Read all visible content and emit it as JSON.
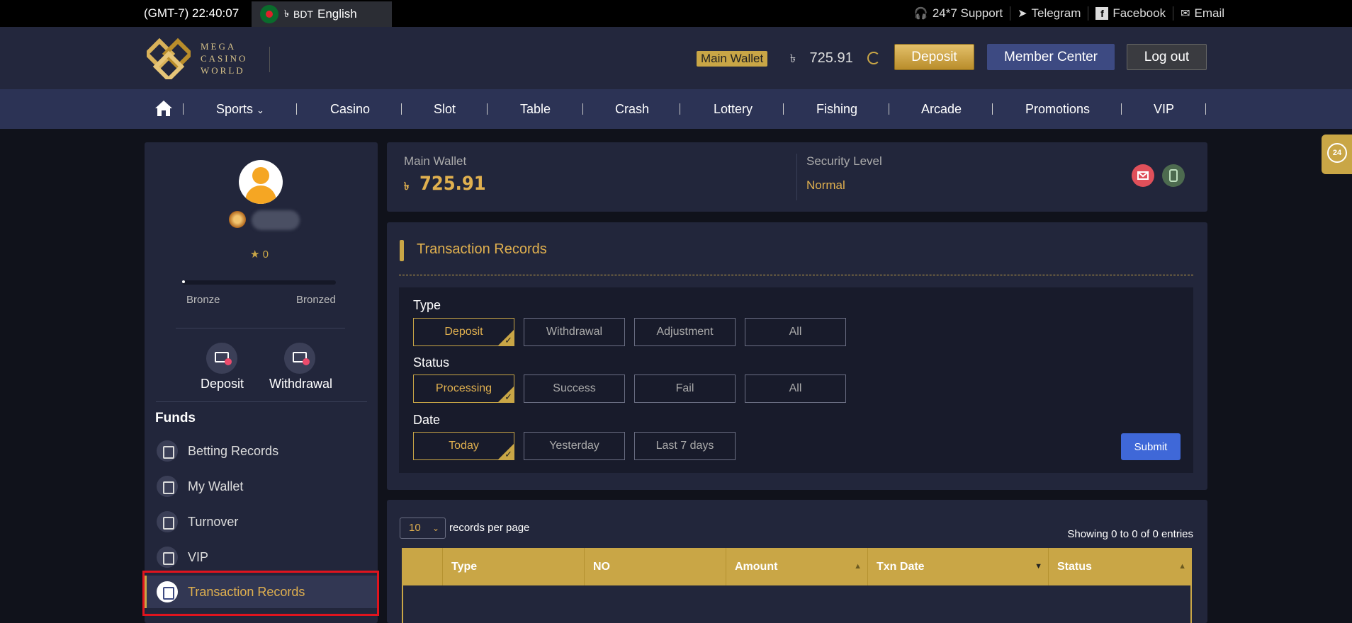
{
  "topbar": {
    "time": "(GMT-7) 22:40:07",
    "currency_symbol": "৳",
    "currency": "BDT",
    "language": "English",
    "links": [
      {
        "label": "24*7 Support",
        "icon": "headset-icon"
      },
      {
        "label": "Telegram",
        "icon": "telegram-icon"
      },
      {
        "label": "Facebook",
        "icon": "facebook-icon"
      },
      {
        "label": "Email",
        "icon": "email-icon"
      }
    ]
  },
  "header": {
    "logo_lines": [
      "MEGA",
      "CASINO",
      "WORLD"
    ],
    "wallet_tag": "Main Wallet",
    "currency_symbol": "৳",
    "balance": "725.91",
    "deposit": "Deposit",
    "member_center": "Member Center",
    "logout": "Log out"
  },
  "nav": {
    "items": [
      "Sports",
      "Casino",
      "Slot",
      "Table",
      "Crash",
      "Lottery",
      "Fishing",
      "Arcade",
      "Promotions",
      "VIP"
    ]
  },
  "profile": {
    "stars": "★ 0",
    "level_from": "Bronze",
    "level_to": "Bronzed",
    "level_progress": 0.01,
    "quick": [
      "Deposit",
      "Withdrawal"
    ]
  },
  "funds": {
    "title": "Funds",
    "items": [
      "Betting Records",
      "My Wallet",
      "Turnover",
      "VIP",
      "Transaction Records"
    ],
    "active_index": 4
  },
  "wallet_panel": {
    "main_wallet_label": "Main Wallet",
    "currency_symbol": "৳",
    "main_wallet_value": "725.91",
    "security_label": "Security Level",
    "security_value": "Normal"
  },
  "transaction": {
    "title": "Transaction Records",
    "type_label": "Type",
    "type_options": [
      "Deposit",
      "Withdrawal",
      "Adjustment",
      "All"
    ],
    "status_label": "Status",
    "status_options": [
      "Processing",
      "Success",
      "Fail",
      "All"
    ],
    "date_label": "Date",
    "date_options": [
      "Today",
      "Yesterday",
      "Last 7 days"
    ],
    "submit": "Submit"
  },
  "table": {
    "per_page_value": "10",
    "per_page_label": "records per page",
    "showing": "Showing 0 to 0 of 0 entries",
    "columns": [
      "",
      "Type",
      "NO",
      "Amount",
      "Txn Date",
      "Status"
    ]
  },
  "colors": {
    "accent_gold": "#c9a646",
    "header_bg": "#23273d",
    "nav_bg": "#2c3355",
    "panel_bg": "#22263b",
    "submit_blue": "#3f68d8",
    "highlight_red": "#e0141e"
  }
}
